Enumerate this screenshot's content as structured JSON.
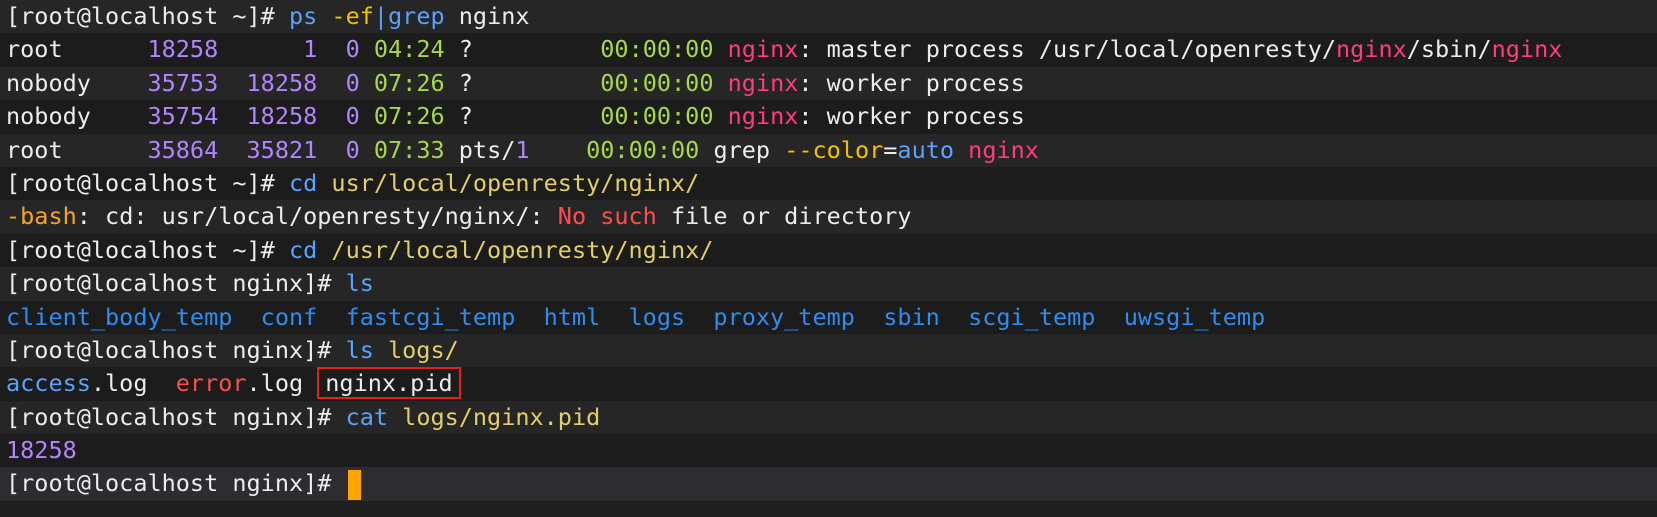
{
  "terminal": {
    "lines": [
      [
        [
          "[root@localhost ~]# ",
          "default"
        ],
        [
          "ps",
          "key"
        ],
        [
          " ",
          "default"
        ],
        [
          "-ef",
          "flag"
        ],
        [
          "|",
          "key"
        ],
        [
          "grep",
          "key"
        ],
        [
          " nginx",
          "default"
        ]
      ],
      [
        [
          "root      ",
          "default"
        ],
        [
          "18258",
          "pid"
        ],
        [
          "      ",
          "default"
        ],
        [
          "1",
          "pid"
        ],
        [
          "  ",
          "default"
        ],
        [
          "0",
          "pid"
        ],
        [
          " ",
          "default"
        ],
        [
          "04:24",
          "time"
        ],
        [
          " ? ",
          "default"
        ],
        [
          "        ",
          "default"
        ],
        [
          "00:00:00",
          "time"
        ],
        [
          " ",
          "default"
        ],
        [
          "nginx",
          "match"
        ],
        [
          ": master process /usr/local/openresty/",
          "default"
        ],
        [
          "nginx",
          "match"
        ],
        [
          "/sbin/",
          "default"
        ],
        [
          "nginx",
          "match"
        ]
      ],
      [
        [
          "nobody    ",
          "default"
        ],
        [
          "35753",
          "pid"
        ],
        [
          "  ",
          "default"
        ],
        [
          "18258",
          "pid"
        ],
        [
          "  ",
          "default"
        ],
        [
          "0",
          "pid"
        ],
        [
          " ",
          "default"
        ],
        [
          "07:26",
          "time"
        ],
        [
          " ? ",
          "default"
        ],
        [
          "        ",
          "default"
        ],
        [
          "00:00:00",
          "time"
        ],
        [
          " ",
          "default"
        ],
        [
          "nginx",
          "match"
        ],
        [
          ": worker process",
          "default"
        ]
      ],
      [
        [
          "nobody    ",
          "default"
        ],
        [
          "35754",
          "pid"
        ],
        [
          "  ",
          "default"
        ],
        [
          "18258",
          "pid"
        ],
        [
          "  ",
          "default"
        ],
        [
          "0",
          "pid"
        ],
        [
          " ",
          "default"
        ],
        [
          "07:26",
          "time"
        ],
        [
          " ? ",
          "default"
        ],
        [
          "        ",
          "default"
        ],
        [
          "00:00:00",
          "time"
        ],
        [
          " ",
          "default"
        ],
        [
          "nginx",
          "match"
        ],
        [
          ": worker process",
          "default"
        ]
      ],
      [
        [
          "root      ",
          "default"
        ],
        [
          "35864",
          "pid"
        ],
        [
          "  ",
          "default"
        ],
        [
          "35821",
          "pid"
        ],
        [
          "  ",
          "default"
        ],
        [
          "0",
          "pid"
        ],
        [
          " ",
          "default"
        ],
        [
          "07:33",
          "time"
        ],
        [
          " pts/",
          "default"
        ],
        [
          "1",
          "pid"
        ],
        [
          "    ",
          "default"
        ],
        [
          "00:00:00",
          "time"
        ],
        [
          " grep ",
          "default"
        ],
        [
          "--color",
          "flag"
        ],
        [
          "=",
          "default"
        ],
        [
          "auto",
          "key"
        ],
        [
          " ",
          "default"
        ],
        [
          "nginx",
          "match"
        ]
      ],
      [
        [
          "[root@localhost ~]# ",
          "default"
        ],
        [
          "cd",
          "key"
        ],
        [
          " ",
          "default"
        ],
        [
          "usr/local/openresty/nginx/",
          "arg"
        ]
      ],
      [
        [
          "-bash",
          "bash"
        ],
        [
          ": cd: usr/local/openresty/nginx/: ",
          "default"
        ],
        [
          "No such",
          "err"
        ],
        [
          " file or directory",
          "default"
        ]
      ],
      [
        [
          "[root@localhost ~]# ",
          "default"
        ],
        [
          "cd",
          "key"
        ],
        [
          " ",
          "default"
        ],
        [
          "/usr/local/openresty/nginx/",
          "arg"
        ]
      ],
      [
        [
          "[root@localhost nginx]# ",
          "default"
        ],
        [
          "ls",
          "key"
        ]
      ],
      [
        [
          "client_body_temp",
          "dir"
        ],
        [
          "  ",
          "default"
        ],
        [
          "conf",
          "dir"
        ],
        [
          "  ",
          "default"
        ],
        [
          "fastcgi_temp",
          "dir"
        ],
        [
          "  ",
          "default"
        ],
        [
          "html",
          "dir"
        ],
        [
          "  ",
          "default"
        ],
        [
          "logs",
          "dir"
        ],
        [
          "  ",
          "default"
        ],
        [
          "proxy_temp",
          "dir"
        ],
        [
          "  ",
          "default"
        ],
        [
          "sbin",
          "dir"
        ],
        [
          "  ",
          "default"
        ],
        [
          "scgi_temp",
          "dir"
        ],
        [
          "  ",
          "default"
        ],
        [
          "uwsgi_temp",
          "dir"
        ]
      ],
      [
        [
          "[root@localhost nginx]# ",
          "default"
        ],
        [
          "ls",
          "key"
        ],
        [
          " ",
          "default"
        ],
        [
          "logs/",
          "arg"
        ]
      ],
      [
        [
          "access",
          "key"
        ],
        [
          ".log  ",
          "default"
        ],
        [
          "error",
          "err"
        ],
        [
          ".log ",
          "default"
        ],
        [
          "nginx.pid",
          "boxed"
        ]
      ],
      [
        [
          "[root@localhost nginx]# ",
          "default"
        ],
        [
          "cat",
          "key"
        ],
        [
          " ",
          "default"
        ],
        [
          "logs/nginx.pid",
          "arg"
        ]
      ],
      [
        [
          "18258",
          "pid"
        ]
      ],
      [
        [
          "[root@localhost nginx]# ",
          "default"
        ],
        [
          "",
          "cursor"
        ]
      ]
    ],
    "colors": {
      "background": "#1f1f1f",
      "text": "#ececec",
      "command": "#5aa2ff",
      "flag": "#f2c200",
      "argument": "#e3cf69",
      "pid": "#b285ff",
      "time": "#a6d84a",
      "grep_match": "#ff3d78",
      "directory": "#2f8cf0",
      "error": "#ff4d4d",
      "highlight_box": "#e1201e",
      "cursor": "#ffa500"
    }
  }
}
